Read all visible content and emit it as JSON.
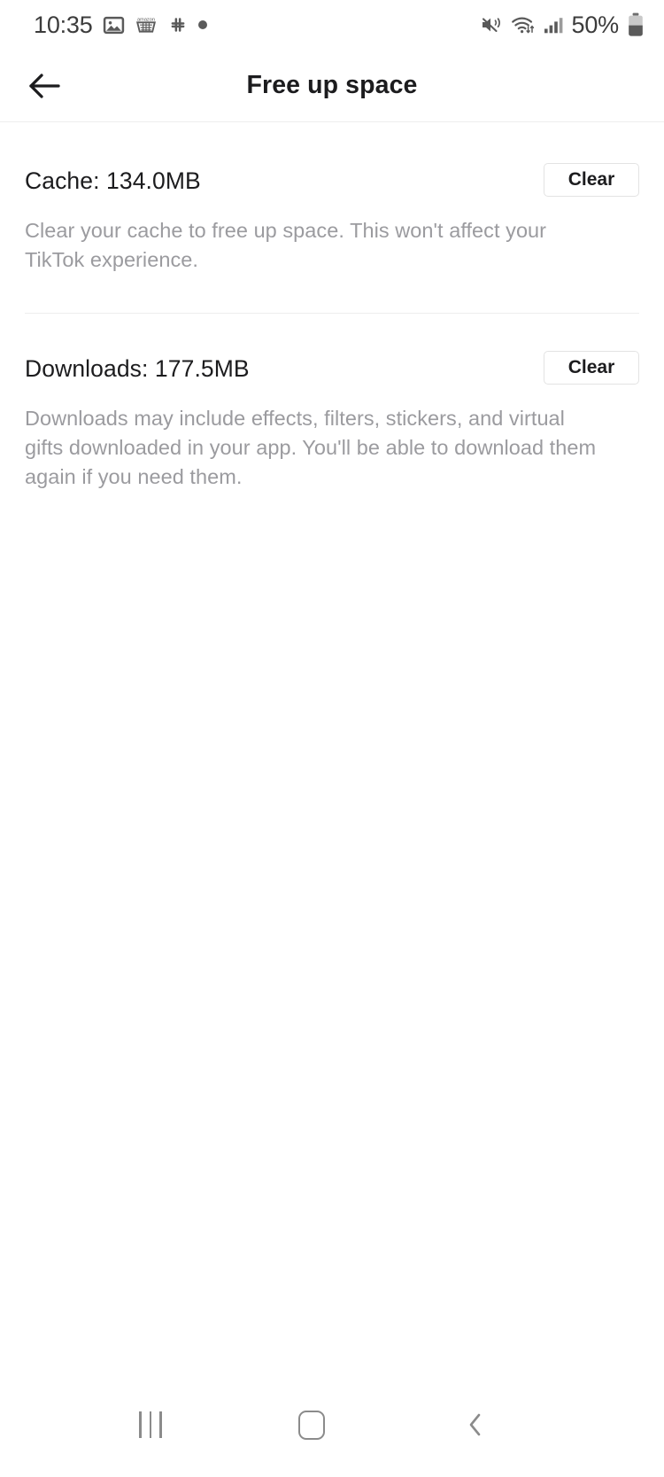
{
  "status_bar": {
    "time": "10:35",
    "battery_percent": "50%",
    "left_icons": [
      "photo-icon",
      "amazon-cart-icon",
      "slack-icon",
      "notification-dot-icon"
    ],
    "right_icons": [
      "mute-vibrate-icon",
      "wifi-icon",
      "cellular-signal-icon",
      "battery-icon"
    ]
  },
  "header": {
    "title": "Free up space",
    "back_icon": "arrow-left-icon"
  },
  "sections": [
    {
      "title": "Cache: 134.0MB",
      "label": "Cache",
      "size": "134.0MB",
      "button_label": "Clear",
      "description": "Clear your cache to free up space. This won't affect your TikTok experience."
    },
    {
      "title": "Downloads: 177.5MB",
      "label": "Downloads",
      "size": "177.5MB",
      "button_label": "Clear",
      "description": "Downloads may include effects, filters, stickers, and virtual gifts downloaded in your app. You'll be able to download them again if you need them."
    }
  ],
  "nav_bar": {
    "recents": "recents-icon",
    "home": "home-icon",
    "back": "back-chevron-icon"
  },
  "colors": {
    "text_primary": "#1c1c1e",
    "text_secondary": "#9b9b9f",
    "divider": "#ededed",
    "background": "#ffffff",
    "nav_icon": "#8b8b8b"
  }
}
